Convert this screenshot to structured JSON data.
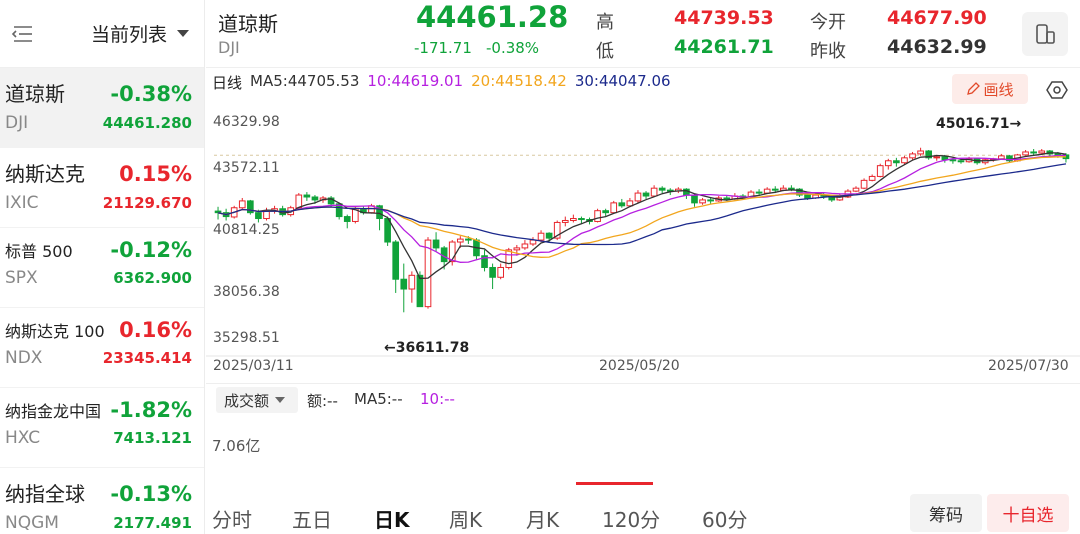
{
  "sidebar": {
    "title": "当前列表",
    "items": [
      {
        "name": "道琼斯",
        "code": "DJI",
        "pct": "-0.38%",
        "value": "44461.280",
        "dir": "down"
      },
      {
        "name": "纳斯达克",
        "code": "IXIC",
        "pct": "0.15%",
        "value": "21129.670",
        "dir": "up"
      },
      {
        "name": "标普 500",
        "code": "SPX",
        "pct": "-0.12%",
        "value": "6362.900",
        "dir": "down"
      },
      {
        "name": "纳斯达克 100",
        "code": "NDX",
        "pct": "0.16%",
        "value": "23345.414",
        "dir": "up"
      },
      {
        "name": "纳指金龙中国",
        "code": "HXC",
        "pct": "-1.82%",
        "value": "7413.121",
        "dir": "down"
      },
      {
        "name": "纳指全球",
        "code": "NQGM",
        "pct": "-0.13%",
        "value": "2177.491",
        "dir": "down"
      }
    ]
  },
  "quote": {
    "name": "道琼斯",
    "code": "DJI",
    "price": "44461.28",
    "change": "-171.71",
    "change_pct": "-0.38%",
    "high_label": "高",
    "high": "44739.53",
    "low_label": "低",
    "low": "44261.71",
    "open_label": "今开",
    "open": "44677.90",
    "prev_close_label": "昨收",
    "prev_close": "44632.99"
  },
  "ma": {
    "label": "日线",
    "ma5": "MA5:44705.53",
    "ma10": "10:44619.01",
    "ma20": "20:44518.42",
    "ma30": "30:44047.06",
    "ma5_color": "#333333",
    "ma10_color": "#b620e0",
    "ma20_color": "#f2a61e",
    "ma30_color": "#1c2a8c"
  },
  "toolbar": {
    "draw_label": "画线"
  },
  "chart_data": {
    "type": "candlestick",
    "y_ticks": [
      "46329.98",
      "43572.11",
      "40814.25",
      "38056.38",
      "35298.51"
    ],
    "ylim": [
      35298.51,
      46329.98
    ],
    "x_ticks": [
      "2025/03/11",
      "2025/05/20",
      "2025/07/30"
    ],
    "annotations": {
      "high": "45016.71→",
      "low": "←36611.78"
    },
    "candles": [
      [
        41780,
        41700,
        42000,
        41350
      ],
      [
        41700,
        41500,
        41900,
        41300
      ],
      [
        41480,
        41950,
        42050,
        41400
      ],
      [
        41950,
        42300,
        42450,
        41850
      ],
      [
        42300,
        41700,
        42350,
        41600
      ],
      [
        41700,
        41400,
        41850,
        41200
      ],
      [
        41400,
        41800,
        41950,
        41300
      ],
      [
        41800,
        41900,
        42050,
        41650
      ],
      [
        41900,
        41600,
        42050,
        41500
      ],
      [
        41600,
        41950,
        42050,
        41500
      ],
      [
        41950,
        42600,
        42700,
        41900
      ],
      [
        42600,
        42500,
        42750,
        42300
      ],
      [
        42500,
        42350,
        42600,
        42150
      ],
      [
        42350,
        42450,
        42550,
        42200
      ],
      [
        42450,
        42150,
        42550,
        42000
      ],
      [
        42150,
        41500,
        42200,
        41350
      ],
      [
        41500,
        41250,
        41600,
        40900
      ],
      [
        41250,
        41900,
        42000,
        41150
      ],
      [
        41900,
        41700,
        42050,
        41600
      ],
      [
        41700,
        42050,
        42150,
        41650
      ],
      [
        42050,
        41400,
        42100,
        40800
      ],
      [
        41400,
        40200,
        41500,
        40000
      ],
      [
        40200,
        38300,
        40300,
        37600
      ],
      [
        38300,
        37800,
        39100,
        36611
      ],
      [
        37800,
        38500,
        38700,
        37100
      ],
      [
        38500,
        36900,
        38700,
        36900
      ],
      [
        36900,
        40300,
        40450,
        36800
      ],
      [
        40300,
        39900,
        40700,
        39700
      ],
      [
        39900,
        39200,
        40000,
        38800
      ],
      [
        39200,
        40200,
        40300,
        39000
      ],
      [
        40200,
        40350,
        40500,
        39900
      ],
      [
        40350,
        40300,
        40500,
        40100
      ],
      [
        40300,
        39500,
        40400,
        39300
      ],
      [
        39500,
        38900,
        39800,
        38700
      ],
      [
        38900,
        38400,
        39100,
        37800
      ],
      [
        38400,
        38900,
        39100,
        38300
      ],
      [
        38900,
        39800,
        39900,
        38800
      ],
      [
        39800,
        39900,
        40050,
        39500
      ],
      [
        39900,
        40100,
        40300,
        39800
      ],
      [
        40100,
        40300,
        40450,
        40000
      ],
      [
        40300,
        40650,
        40800,
        40200
      ],
      [
        40650,
        40400,
        40700,
        40200
      ],
      [
        40400,
        41200,
        41300,
        40300
      ],
      [
        41200,
        41300,
        41500,
        41000
      ],
      [
        41300,
        41400,
        41600,
        41200
      ],
      [
        41400,
        41350,
        41500,
        41150
      ],
      [
        41350,
        41250,
        41450,
        41100
      ],
      [
        41250,
        41800,
        41900,
        41200
      ],
      [
        41800,
        41700,
        41900,
        41500
      ],
      [
        41700,
        42200,
        42300,
        41650
      ],
      [
        42200,
        42050,
        42400,
        41950
      ],
      [
        42050,
        42300,
        42450,
        42000
      ],
      [
        42300,
        42700,
        42850,
        42200
      ],
      [
        42700,
        42550,
        42800,
        42400
      ],
      [
        42550,
        42950,
        43100,
        42500
      ],
      [
        42950,
        42850,
        43050,
        42700
      ],
      [
        42850,
        42800,
        42950,
        42600
      ],
      [
        42800,
        42900,
        43000,
        42700
      ],
      [
        42900,
        42600,
        42950,
        42400
      ],
      [
        42600,
        42200,
        42650,
        42000
      ],
      [
        42200,
        42350,
        42450,
        42100
      ],
      [
        42350,
        42300,
        42500,
        42150
      ],
      [
        42300,
        42450,
        42550,
        42250
      ],
      [
        42450,
        42400,
        42600,
        42300
      ],
      [
        42400,
        42550,
        42700,
        42350
      ],
      [
        42550,
        42500,
        42650,
        42400
      ],
      [
        42500,
        42750,
        42850,
        42450
      ],
      [
        42750,
        42700,
        42900,
        42550
      ],
      [
        42700,
        42900,
        43000,
        42650
      ],
      [
        42900,
        42850,
        43050,
        42700
      ],
      [
        42850,
        42950,
        43100,
        42800
      ],
      [
        42950,
        42900,
        43100,
        42800
      ],
      [
        42900,
        42600,
        42950,
        42500
      ],
      [
        42600,
        42450,
        42650,
        42350
      ],
      [
        42450,
        42600,
        42700,
        42400
      ],
      [
        42600,
        42550,
        42700,
        42400
      ],
      [
        42550,
        42350,
        42600,
        42250
      ],
      [
        42350,
        42500,
        42650,
        42300
      ],
      [
        42500,
        42800,
        42900,
        42450
      ],
      [
        42800,
        42950,
        43050,
        42750
      ],
      [
        42950,
        43350,
        43450,
        42900
      ],
      [
        43350,
        43550,
        43650,
        43300
      ],
      [
        43550,
        44100,
        44200,
        43500
      ],
      [
        44100,
        44350,
        44450,
        43900
      ],
      [
        44350,
        44250,
        44500,
        44050
      ],
      [
        44250,
        44500,
        44600,
        44150
      ],
      [
        44500,
        44700,
        44800,
        44400
      ],
      [
        44700,
        44850,
        45016,
        44600
      ],
      [
        44850,
        44500,
        44900,
        44400
      ],
      [
        44500,
        44550,
        44650,
        44350
      ],
      [
        44550,
        44400,
        44650,
        44250
      ],
      [
        44400,
        44350,
        44500,
        44200
      ],
      [
        44350,
        44300,
        44450,
        44200
      ],
      [
        44300,
        44450,
        44550,
        44250
      ],
      [
        44450,
        44250,
        44500,
        44150
      ],
      [
        44250,
        44400,
        44450,
        44150
      ],
      [
        44400,
        44450,
        44500,
        44300
      ],
      [
        44450,
        44600,
        44700,
        44400
      ],
      [
        44600,
        44350,
        44650,
        44250
      ],
      [
        44350,
        44650,
        44700,
        44300
      ],
      [
        44650,
        44800,
        44900,
        44600
      ],
      [
        44800,
        44750,
        44950,
        44600
      ],
      [
        44750,
        44850,
        44950,
        44700
      ],
      [
        44850,
        44700,
        44900,
        44550
      ],
      [
        44700,
        44650,
        44800,
        44500
      ],
      [
        44650,
        44461,
        44739,
        44261
      ]
    ]
  },
  "volume": {
    "selector": "成交额",
    "amount_label": "额:--",
    "ma5_label": "MA5:--",
    "ma10_label": "10:--",
    "y_label": "7.06亿"
  },
  "tabs": [
    "分时",
    "五日",
    "日K",
    "周K",
    "月K",
    "120分",
    "60分"
  ],
  "active_tab": "日K",
  "buttons": {
    "chips": "筹码",
    "watch": "十自选"
  },
  "colors": {
    "up": "#e8262d",
    "down": "#10a33a",
    "accent": "#e24a2a"
  }
}
